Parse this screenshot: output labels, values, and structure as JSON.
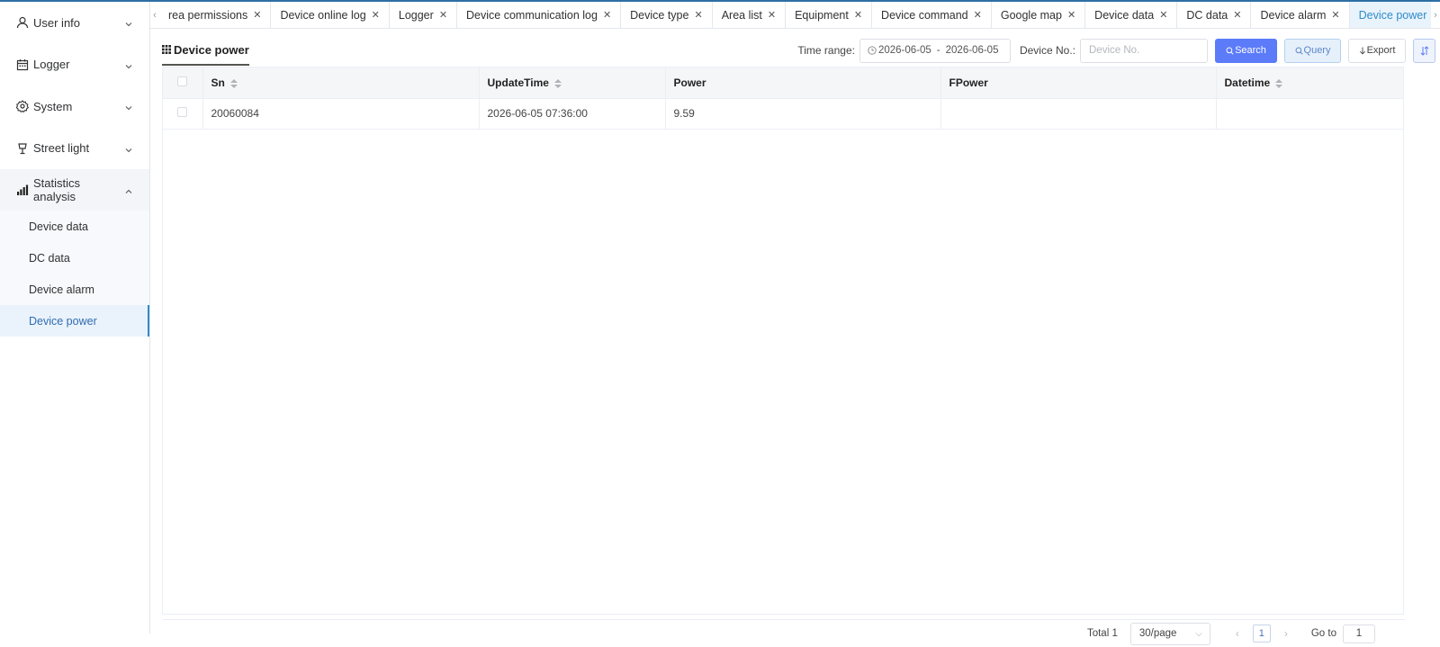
{
  "sidebar": {
    "items": [
      {
        "label": "User info",
        "icon": "user-icon"
      },
      {
        "label": "Logger",
        "icon": "calendar-icon"
      },
      {
        "label": "System",
        "icon": "gear-icon"
      },
      {
        "label": "Street light",
        "icon": "lamp-icon"
      },
      {
        "label": "Statistics analysis",
        "icon": "bar-chart-icon"
      }
    ],
    "submenu": [
      {
        "label": "Device data"
      },
      {
        "label": "DC data"
      },
      {
        "label": "Device alarm"
      },
      {
        "label": "Device power"
      }
    ],
    "active_submenu": "Device power"
  },
  "tabs": [
    {
      "label": "rea permissions"
    },
    {
      "label": "Device online log"
    },
    {
      "label": "Logger"
    },
    {
      "label": "Device communication log"
    },
    {
      "label": "Device type"
    },
    {
      "label": "Area list"
    },
    {
      "label": "Equipment"
    },
    {
      "label": "Device command"
    },
    {
      "label": "Google map"
    },
    {
      "label": "Device data"
    },
    {
      "label": "DC data"
    },
    {
      "label": "Device alarm"
    },
    {
      "label": "Device power"
    }
  ],
  "panel": {
    "title": "Device power",
    "filters": {
      "time_range_label": "Time range:",
      "date_start": "2026-06-05",
      "date_sep": "-",
      "date_end": "2026-06-05",
      "device_no_label": "Device No.:",
      "device_no_placeholder": "Device No.",
      "search_label": "Search",
      "query_label": "Query",
      "export_label": "Export"
    },
    "table": {
      "columns": [
        "Sn",
        "UpdateTime",
        "Power",
        "FPower",
        "Datetime"
      ],
      "rows": [
        {
          "sn": "20060084",
          "update_time": "2026-06-05 07:36:00",
          "power": "9.59",
          "fpower": "",
          "datetime": ""
        }
      ]
    },
    "pagination": {
      "total": "Total 1",
      "page_size": "30/page",
      "current_page": "1",
      "goto_label": "Go to",
      "goto_value": "1"
    }
  },
  "colors": {
    "accent": "#2f8bc9",
    "search_button": "#5b7bf9",
    "topline": "#2d6fa5"
  }
}
